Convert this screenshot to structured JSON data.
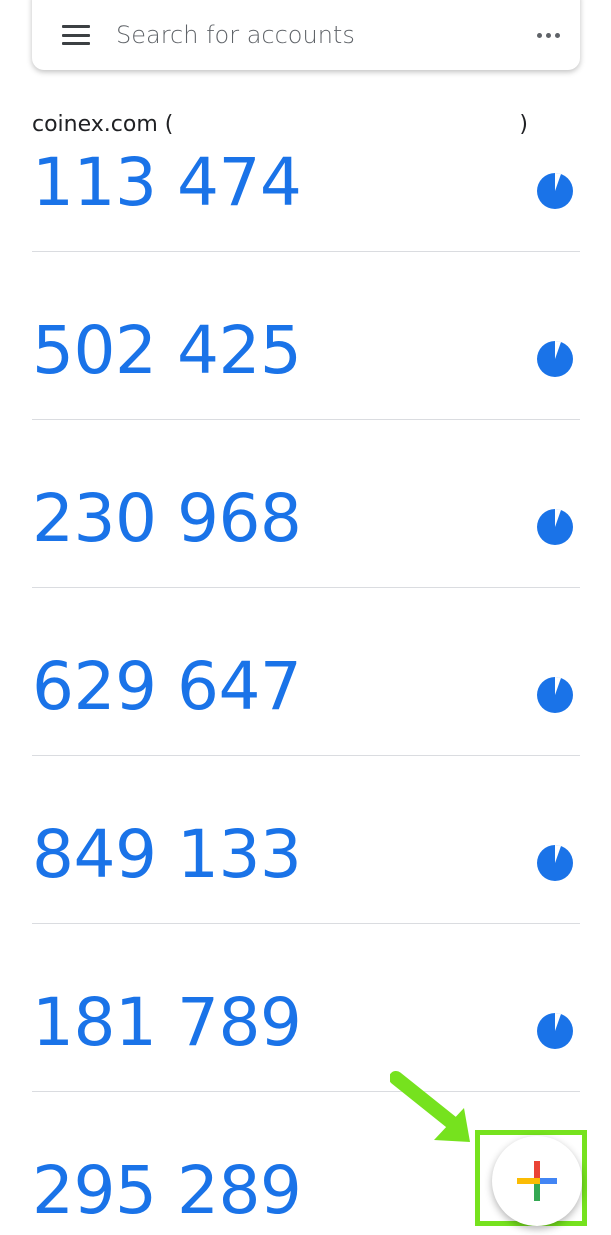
{
  "search": {
    "placeholder": "Search for accounts"
  },
  "icons": {
    "menu": "menu-icon",
    "more": "more-vert-icon",
    "timer": "countdown-timer-icon",
    "add": "add-plus-icon"
  },
  "colors": {
    "code_blue": "#1a73e8",
    "highlight_green": "#76e21e",
    "plus_red": "#ea4335",
    "plus_blue": "#4285f4",
    "plus_green": "#34a853",
    "plus_yellow": "#fbbc04"
  },
  "accounts": [
    {
      "name": "coinex.com (",
      "name_close": ")",
      "code": "113 474"
    },
    {
      "name": "",
      "name_close": "",
      "code": "502 425"
    },
    {
      "name": "",
      "name_close": "",
      "code": "230 968"
    },
    {
      "name": "",
      "name_close": "",
      "code": "629 647"
    },
    {
      "name": "",
      "name_close": "",
      "code": "849 133"
    },
    {
      "name": "",
      "name_close": "",
      "code": "181 789"
    },
    {
      "name": "",
      "name_close": "",
      "code": "295 289"
    }
  ]
}
